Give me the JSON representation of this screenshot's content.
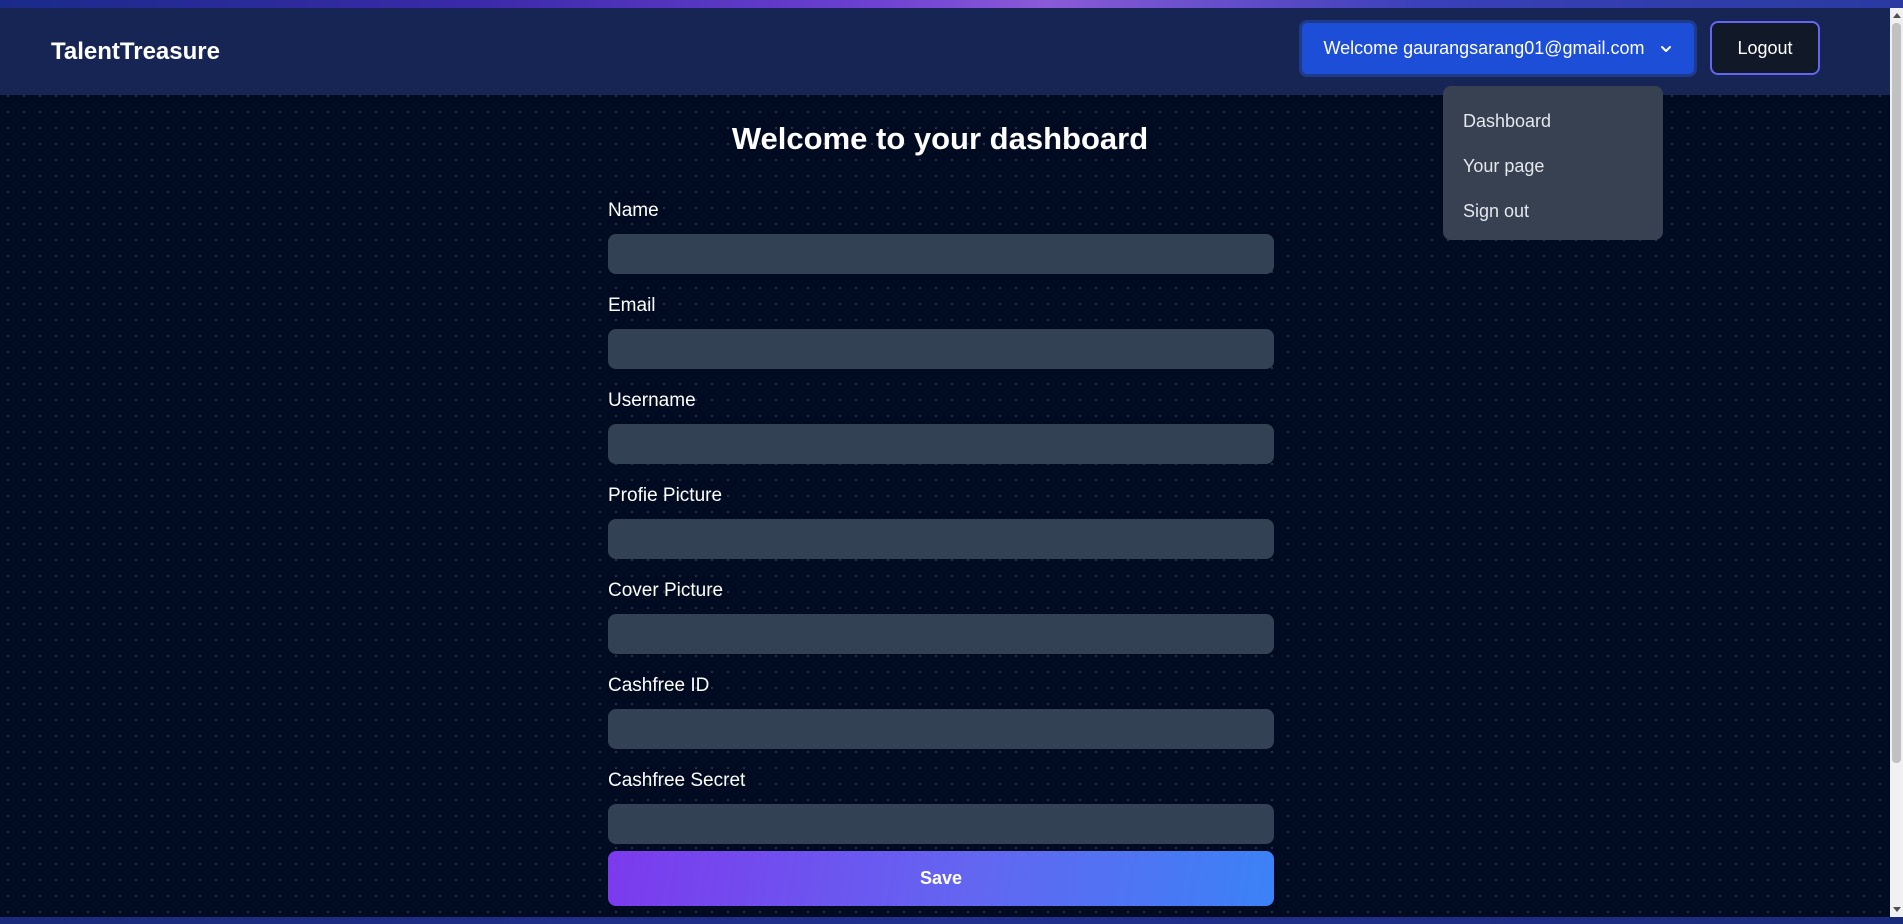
{
  "header": {
    "brand": "TalentTreasure",
    "welcome_label": "Welcome gaurangsarang01@gmail.com",
    "logout_label": "Logout"
  },
  "dropdown": {
    "items": [
      {
        "label": "Dashboard"
      },
      {
        "label": "Your page"
      },
      {
        "label": "Sign out"
      }
    ]
  },
  "main": {
    "title": "Welcome to your dashboard",
    "fields": [
      {
        "label": "Name",
        "value": ""
      },
      {
        "label": "Email",
        "value": ""
      },
      {
        "label": "Username",
        "value": ""
      },
      {
        "label": "Profie Picture",
        "value": ""
      },
      {
        "label": "Cover Picture",
        "value": ""
      },
      {
        "label": "Cashfree ID",
        "value": ""
      },
      {
        "label": "Cashfree Secret",
        "value": ""
      }
    ],
    "save_label": "Save"
  },
  "colors": {
    "page_background": "#000a20",
    "navbar": "#172554",
    "welcome_button": "#1d4ed8",
    "input_background": "#334155",
    "dropdown_background": "#374151",
    "save_gradient_start": "#7c3aed",
    "save_gradient_end": "#3b82f6"
  },
  "icons": {
    "dropdown_toggle": "chevron-down-icon"
  }
}
